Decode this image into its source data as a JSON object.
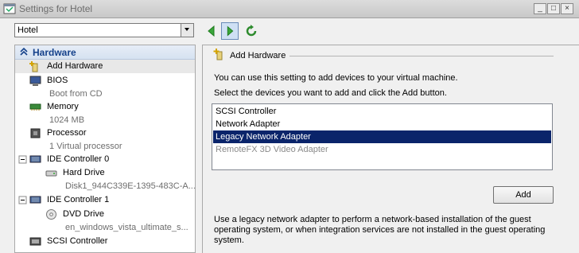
{
  "window": {
    "title": "Settings for Hotel",
    "controls": {
      "minimize": "_",
      "restore": "□",
      "close": "×"
    }
  },
  "toolbar": {
    "vm_selector": "Hotel",
    "icons": [
      "back-arrow-icon",
      "forward-arrow-icon",
      "refresh-icon"
    ]
  },
  "sidebar": {
    "group_label": "Hardware",
    "items": [
      {
        "label": "Add Hardware",
        "icon": "add-hardware-icon"
      },
      {
        "label": "BIOS",
        "sub": "Boot from CD",
        "icon": "bios-icon"
      },
      {
        "label": "Memory",
        "sub": "1024 MB",
        "icon": "memory-icon"
      },
      {
        "label": "Processor",
        "sub": "1 Virtual processor",
        "icon": "processor-icon"
      },
      {
        "label": "IDE Controller 0",
        "icon": "ide-controller-icon"
      },
      {
        "label": "Hard Drive",
        "sub": "Disk1_944C339E-1395-483C-A...",
        "icon": "hard-drive-icon"
      },
      {
        "label": "IDE Controller 1",
        "icon": "ide-controller-icon"
      },
      {
        "label": "DVD Drive",
        "sub": "en_windows_vista_ultimate_s...",
        "icon": "dvd-drive-icon"
      },
      {
        "label": "SCSI Controller",
        "icon": "scsi-controller-icon"
      }
    ]
  },
  "main": {
    "section_title": "Add Hardware",
    "intro": "You can use this setting to add devices to your virtual machine.",
    "instruction": "Select the devices you want to add and click the Add button.",
    "devices": [
      {
        "label": "SCSI Controller",
        "state": "normal"
      },
      {
        "label": "Network Adapter",
        "state": "normal"
      },
      {
        "label": "Legacy Network Adapter",
        "state": "selected"
      },
      {
        "label": "RemoteFX 3D Video Adapter",
        "state": "disabled"
      }
    ],
    "add_button": "Add",
    "description_lines": [
      "Use a legacy network adapter to perform a network-based installation of the guest",
      "operating system, or when integration services are not installed in the guest operating",
      "system."
    ]
  },
  "colors": {
    "selection": "#0a246a",
    "group_header_text": "#15428b",
    "disabled_text": "#8a8a8a",
    "arrow_green": "#3aa63a"
  }
}
